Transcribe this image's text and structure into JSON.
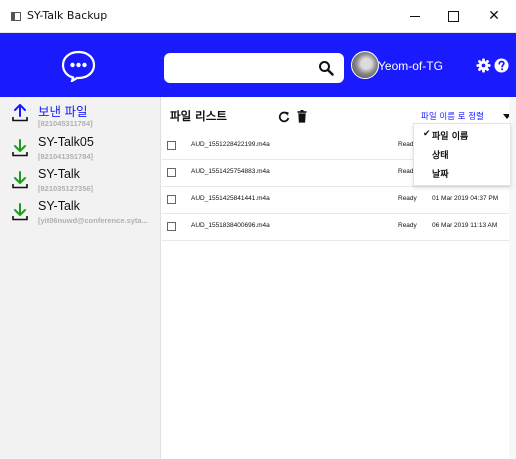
{
  "window": {
    "title": "SY-Talk Backup",
    "close_label": "✕"
  },
  "header": {
    "search": {
      "value": "",
      "placeholder": ""
    },
    "user_name": "Yeom-of-TG",
    "colors": {
      "brand": "#1a1aff"
    }
  },
  "sidebar": {
    "items": [
      {
        "title": "보낸 파일",
        "sub": "[821045311784]",
        "icon": "upload-icon",
        "title_color": "#1a1aff",
        "icon_color": "#1a1aff"
      },
      {
        "title": "SY-Talk05",
        "sub": "[821041351784]",
        "icon": "download-icon",
        "title_color": "#111111",
        "icon_color": "#1e9b1e"
      },
      {
        "title": "SY-Talk",
        "sub": "[821035127356]",
        "icon": "download-icon",
        "title_color": "#111111",
        "icon_color": "#1e9b1e"
      },
      {
        "title": "SY-Talk",
        "sub": "[yit06nuwd@conference.syta...",
        "icon": "download-icon",
        "title_color": "#111111",
        "icon_color": "#1e9b1e"
      }
    ]
  },
  "main": {
    "list_title": "파일 리스트",
    "sort_label": "파일 이름 로 정렬",
    "sort_options": [
      {
        "label": "파일 이름",
        "selected": true
      },
      {
        "label": "상태",
        "selected": false
      },
      {
        "label": "날짜",
        "selected": false
      }
    ],
    "files": [
      {
        "name": "AUD_1551228422199.m4a",
        "status": "Ready",
        "date": ""
      },
      {
        "name": "AUD_1551425754883.m4a",
        "status": "Ready",
        "date": ""
      },
      {
        "name": "AUD_1551425841441.m4a",
        "status": "Ready",
        "date": "01 Mar 2019 04:37 PM"
      },
      {
        "name": "AUD_1551838400696.m4a",
        "status": "Ready",
        "date": "06 Mar 2019 11:13 AM"
      }
    ]
  }
}
